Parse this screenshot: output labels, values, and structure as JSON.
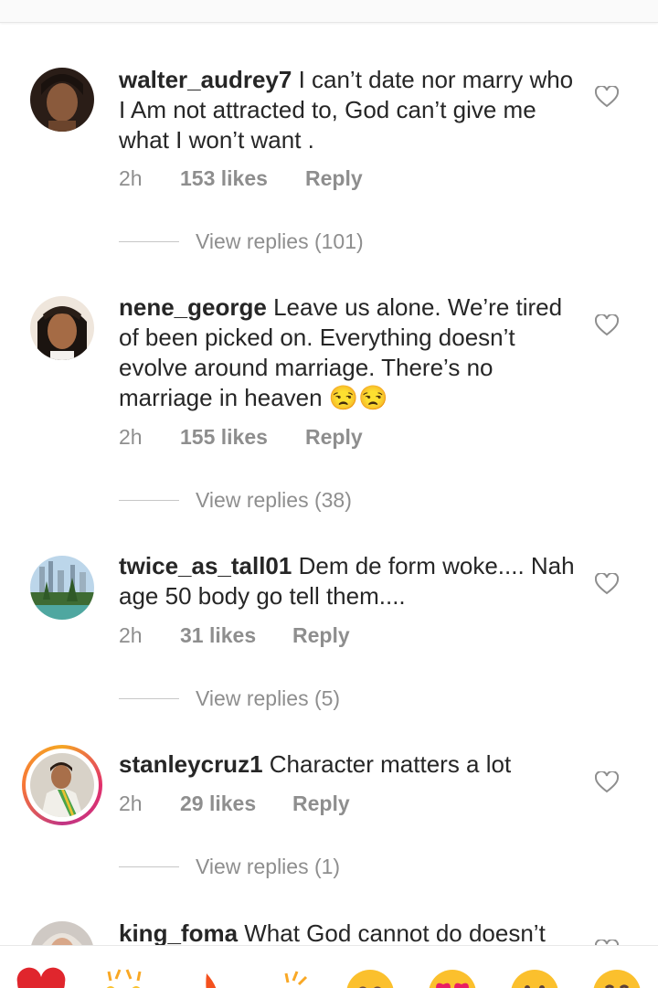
{
  "comments": [
    {
      "username": "walter_audrey7",
      "text": "I can’t date nor marry who I Am not attracted to, God can’t give me what I won’t want .",
      "time": "2h",
      "likes": "153 likes",
      "reply": "Reply",
      "view_replies": "View replies (101)"
    },
    {
      "username": "nene_george",
      "text": "Leave us alone. We’re tired of been picked on. Everything doesn’t evolve around marriage. There’s no marriage in heaven 😒😒",
      "time": "2h",
      "likes": "155 likes",
      "reply": "Reply",
      "view_replies": "View replies (38)"
    },
    {
      "username": "twice_as_tall01",
      "text": "Dem de form woke.... Nah age 50 body go tell them....",
      "time": "2h",
      "likes": "31 likes",
      "reply": "Reply",
      "view_replies": "View replies (5)"
    },
    {
      "username": "stanleycruz1",
      "text": "Character matters a lot",
      "time": "2h",
      "likes": "29 likes",
      "reply": "Reply",
      "view_replies": "View replies (1)"
    },
    {
      "username": "king_foma",
      "text": "What God cannot do doesn’t"
    }
  ],
  "icons": {
    "like": "heart-outline-icon",
    "quick_reactions": [
      "red-heart",
      "raising-hands",
      "fire",
      "clapping-hands",
      "crying-face",
      "heart-eyes",
      "astonished-face",
      "smiling-face"
    ]
  },
  "colors": {
    "username": "#262626",
    "meta": "#8e8e8e",
    "heart": "#ed4956",
    "story_ring": "#e1306c"
  }
}
